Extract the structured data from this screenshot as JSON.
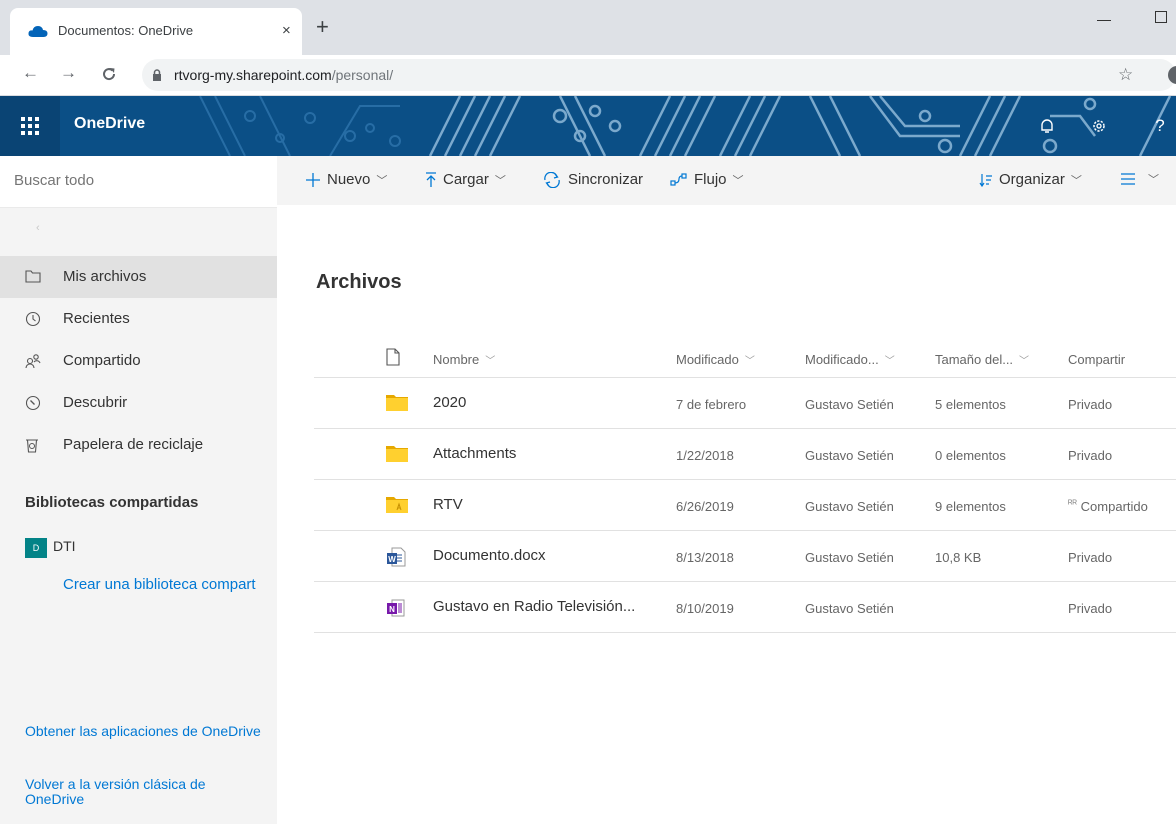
{
  "browser": {
    "tab_title": "Documentos: OneDrive",
    "tab_close": "×",
    "new_tab": "+",
    "url_domain": "rtvorg-my.sharepoint.com",
    "url_path": "/personal/"
  },
  "suite": {
    "app_name": "OneDrive",
    "help_label": "?"
  },
  "search": {
    "placeholder": "Buscar todo"
  },
  "nav": {
    "items": [
      {
        "label": "Mis archivos",
        "icon": "folder-icon"
      },
      {
        "label": "Recientes",
        "icon": "clock-icon"
      },
      {
        "label": "Compartido",
        "icon": "people-icon"
      },
      {
        "label": "Descubrir",
        "icon": "compass-icon"
      },
      {
        "label": "Papelera de reciclaje",
        "icon": "recycle-bin-icon"
      }
    ],
    "shared_section_title": "Bibliotecas compartidas",
    "library_badge": "D",
    "library_name": "DTI",
    "create_library": "Crear una biblioteca compart",
    "get_apps": "Obtener las aplicaciones de OneDrive",
    "classic_view": "Volver a la versión clásica de OneDrive"
  },
  "commands": {
    "new": "Nuevo",
    "upload": "Cargar",
    "sync": "Sincronizar",
    "flow": "Flujo",
    "sort": "Organizar"
  },
  "main": {
    "title": "Archivos"
  },
  "columns": {
    "name": "Nombre",
    "modified": "Modificado",
    "modified_by": "Modificado...",
    "size": "Tamaño del...",
    "sharing": "Compartir"
  },
  "files": [
    {
      "name": "2020",
      "type": "folder",
      "modified": "7 de febrero",
      "modified_by": "Gustavo Setién",
      "size": "5 elementos",
      "sharing": "Privado"
    },
    {
      "name": "Attachments",
      "type": "folder",
      "modified": "1/22/2018",
      "modified_by": "Gustavo Setién",
      "size": "0 elementos",
      "sharing": "Privado"
    },
    {
      "name": "RTV",
      "type": "shared-folder",
      "modified": "6/26/2019",
      "modified_by": "Gustavo Setién",
      "size": "9 elementos",
      "sharing": "Compartido"
    },
    {
      "name": "Documento.docx",
      "type": "word",
      "modified": "8/13/2018",
      "modified_by": "Gustavo Setién",
      "size": "10,8 KB",
      "sharing": "Privado"
    },
    {
      "name": "Gustavo en Radio Televisión...",
      "type": "onenote",
      "modified": "8/10/2019",
      "modified_by": "Gustavo Setién",
      "size": "",
      "sharing": "Privado"
    }
  ],
  "colors": {
    "suite_bar": "#0b4f86",
    "accent": "#0078d4",
    "folder": "#ffd02f",
    "word": "#2b579a",
    "onenote": "#7719aa",
    "library_badge": "#038387"
  }
}
